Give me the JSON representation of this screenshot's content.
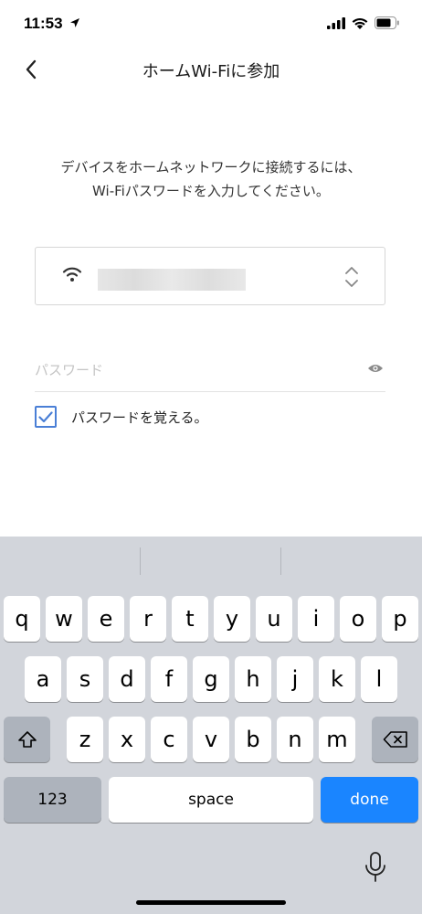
{
  "status": {
    "time": "11:53"
  },
  "nav": {
    "title": "ホームWi-Fiに参加"
  },
  "instruction": {
    "line1": "デバイスをホームネットワークに接続するには、",
    "line2": "Wi-Fiパスワードを入力してください。"
  },
  "wifi": {
    "ssid": ""
  },
  "password": {
    "placeholder": "パスワード",
    "value": ""
  },
  "remember": {
    "label": "パスワードを覚える。",
    "checked": true
  },
  "keyboard": {
    "row1": [
      "q",
      "w",
      "e",
      "r",
      "t",
      "y",
      "u",
      "i",
      "o",
      "p"
    ],
    "row2": [
      "a",
      "s",
      "d",
      "f",
      "g",
      "h",
      "j",
      "k",
      "l"
    ],
    "row3": [
      "z",
      "x",
      "c",
      "v",
      "b",
      "n",
      "m"
    ],
    "numbers_label": "123",
    "space_label": "space",
    "done_label": "done"
  },
  "colors": {
    "accent": "#1a85ff",
    "checkbox": "#4a7fd6",
    "keyboard_bg": "#d2d5db"
  }
}
